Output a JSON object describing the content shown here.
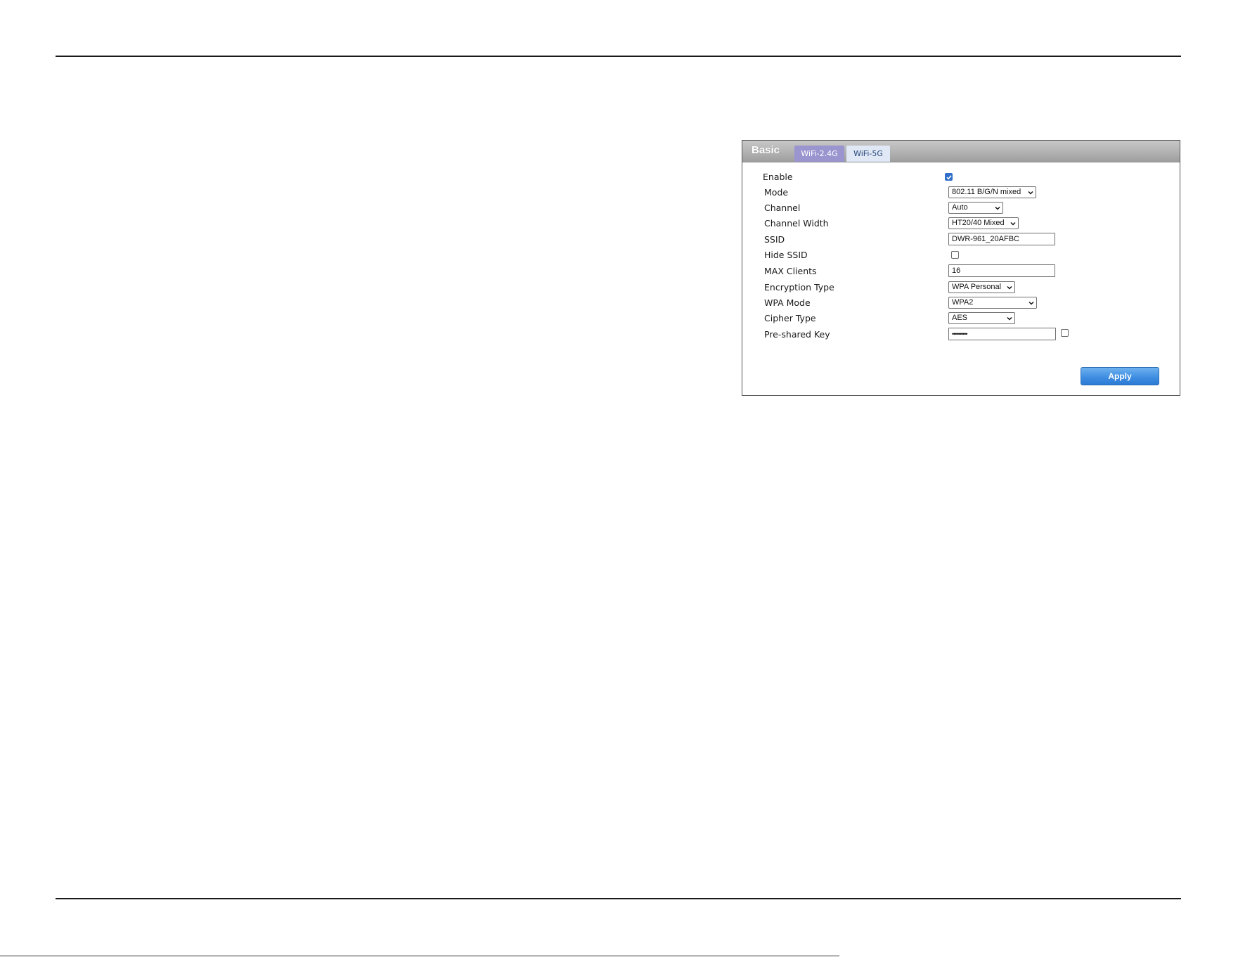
{
  "panel": {
    "title": "Basic",
    "tabs": [
      {
        "label": "WiFi-2.4G",
        "active": true
      },
      {
        "label": "WiFi-5G",
        "active": false
      }
    ]
  },
  "form": {
    "enable": {
      "label": "Enable",
      "checked": true
    },
    "mode": {
      "label": "Mode",
      "value": "802.11 B/G/N mixed"
    },
    "channel": {
      "label": "Channel",
      "value": "Auto"
    },
    "channel_width": {
      "label": "Channel Width",
      "value": "HT20/40 Mixed"
    },
    "ssid": {
      "label": "SSID",
      "value": "DWR-961_20AFBC"
    },
    "hide_ssid": {
      "label": "Hide SSID",
      "checked": false
    },
    "max_clients": {
      "label": "MAX Clients",
      "value": "16"
    },
    "encryption_type": {
      "label": "Encryption Type",
      "value": "WPA Personal"
    },
    "wpa_mode": {
      "label": "WPA Mode",
      "value": "WPA2"
    },
    "cipher_type": {
      "label": "Cipher Type",
      "value": "AES"
    },
    "preshared_key": {
      "label": "Pre-shared Key",
      "value": "••••••••••",
      "show_checked": false
    }
  },
  "buttons": {
    "apply_label": "Apply"
  },
  "colors": {
    "tab_active": "#9a95cf",
    "tab_inactive": "#dfe8f4",
    "apply_button": "#3f8fe2",
    "checkbox_checked": "#2f6fc9"
  },
  "icons": {
    "select_caret": "chevron-down-icon",
    "checkmark": "checkmark-icon"
  }
}
